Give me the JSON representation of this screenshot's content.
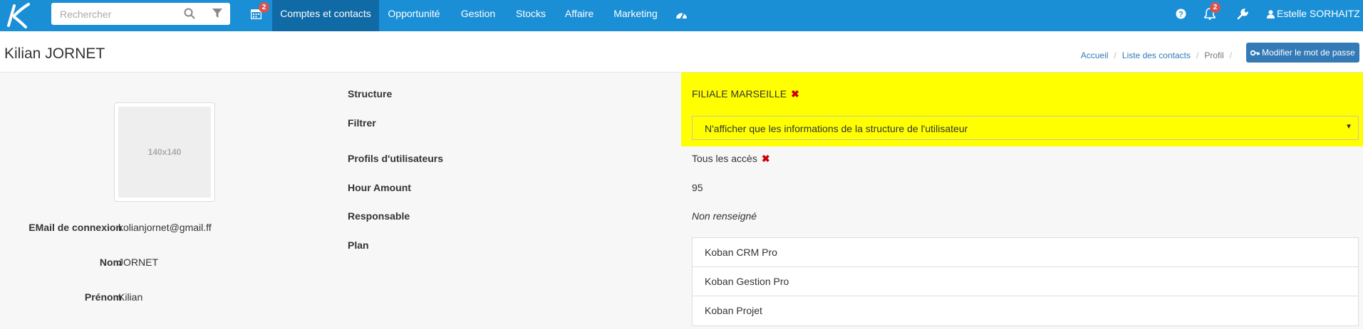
{
  "nav": {
    "search_placeholder": "Rechercher",
    "calendar_badge": "2",
    "items": [
      "Comptes et contacts",
      "Opportunité",
      "Gestion",
      "Stocks",
      "Affaire",
      "Marketing"
    ],
    "notifications_badge": "2",
    "user_name": "Estelle SORHAITZ",
    "icons": [
      "logo-k",
      "search-icon",
      "filter-icon",
      "calendar-icon",
      "dashboard-icon",
      "help-icon",
      "bell-icon",
      "wrench-icon",
      "user-icon",
      "caret-down-icon"
    ]
  },
  "header": {
    "title": "Kilian JORNET",
    "breadcrumb": [
      "Accueil",
      "Liste des contacts",
      "Profil"
    ],
    "change_password": "Modifier le mot de passe"
  },
  "avatar": {
    "placeholder": "140x140"
  },
  "left_fields": [
    {
      "label": "EMail de connexion",
      "value": "kolianjornet@gmail.ff"
    },
    {
      "label": "Nom",
      "value": "JORNET"
    },
    {
      "label": "Prénom",
      "value": "Kilian"
    }
  ],
  "right_fields": {
    "structure": {
      "label": "Structure",
      "value": "FILIALE MARSEILLE"
    },
    "filter": {
      "label": "Filtrer",
      "value": "N'afficher que les informations de la structure de l'utilisateur"
    },
    "profiles": {
      "label": "Profils d'utilisateurs",
      "value": "Tous les accès"
    },
    "hour_amount": {
      "label": "Hour Amount",
      "value": "95"
    },
    "responsable": {
      "label": "Responsable",
      "value": "Non renseigné"
    },
    "plan": {
      "label": "Plan",
      "items": [
        "Koban CRM Pro",
        "Koban Gestion Pro",
        "Koban Projet"
      ]
    }
  },
  "colors": {
    "nav_bg": "#1b8fd6",
    "nav_active": "#106aa5",
    "highlight": "#ffff00",
    "button": "#337ab7",
    "badge": "#d9534f"
  }
}
